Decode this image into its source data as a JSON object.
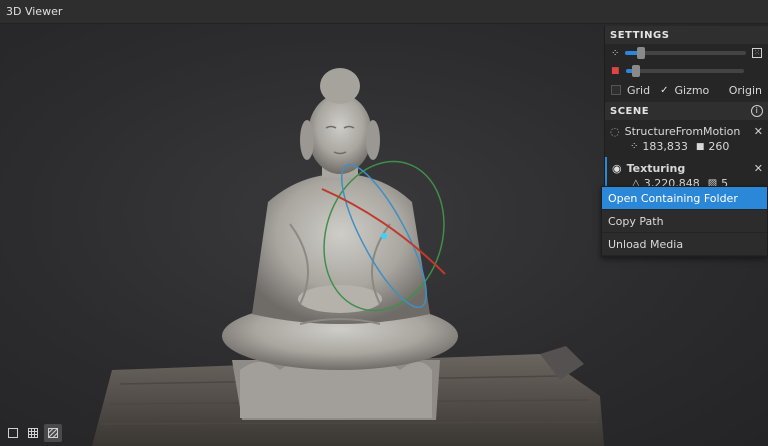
{
  "window": {
    "title": "3D Viewer"
  },
  "settings": {
    "header": "SETTINGS",
    "point_size_level": 0.12,
    "camera_scale_level": 0.08,
    "grid_label": "Grid",
    "grid_checked": false,
    "gizmo_label": "Gizmo",
    "gizmo_checked": true,
    "origin_label": "Origin"
  },
  "scene": {
    "header": "SCENE",
    "items": [
      {
        "name": "StructureFromMotion",
        "points": "183,833",
        "cameras": "260",
        "visible": false
      },
      {
        "name": "Texturing",
        "vertices": "3,220,848",
        "textures": "5",
        "visible": true
      }
    ]
  },
  "context_menu": {
    "items": [
      "Open Containing Folder",
      "Copy Path",
      "Unload Media"
    ],
    "highlighted": 0
  },
  "view_toolbar": {
    "modes": [
      "solid",
      "wireframe",
      "textured"
    ],
    "active": "textured"
  },
  "colors": {
    "accent": "#2b87d8",
    "panel": "#262627",
    "background": "#2b2b2b"
  }
}
